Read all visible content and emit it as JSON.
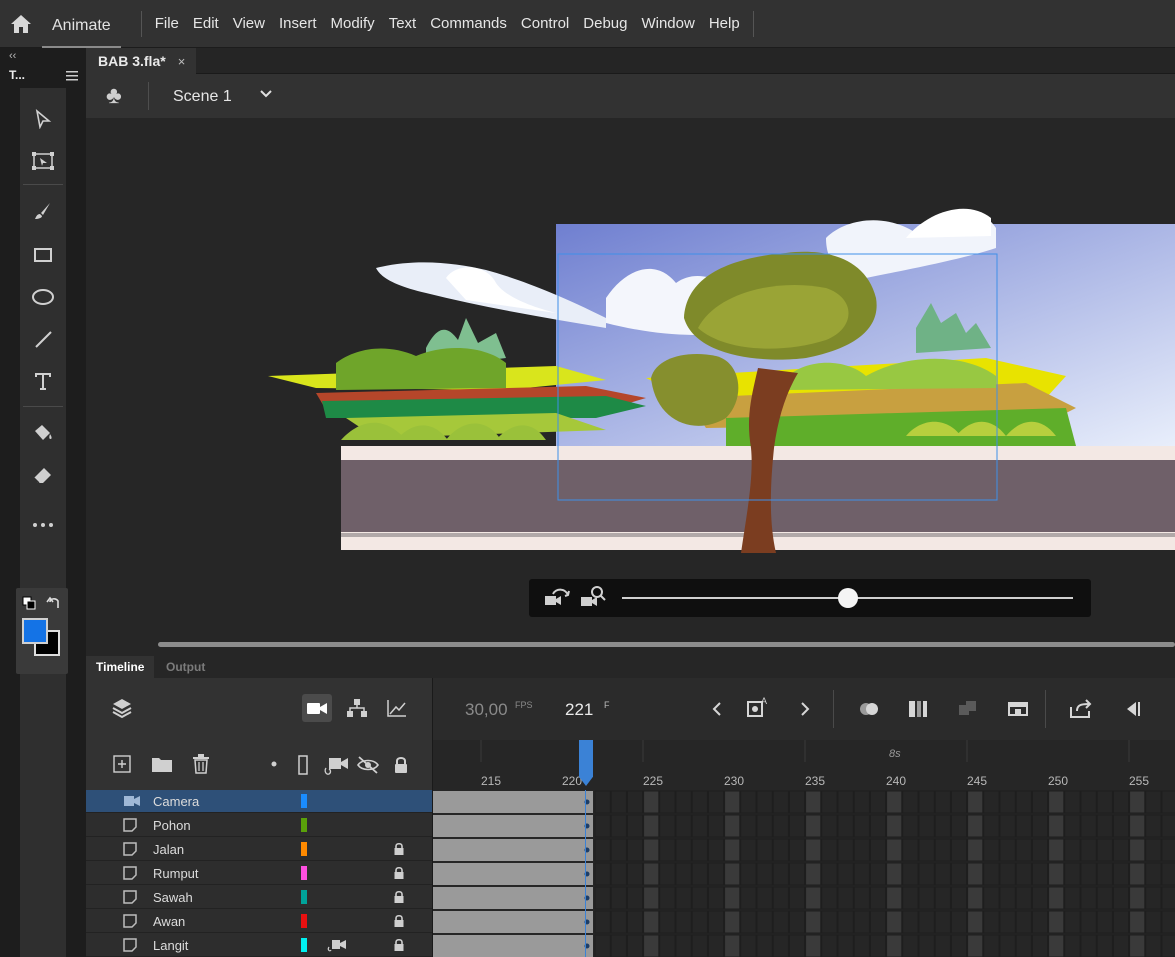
{
  "app": {
    "name": "Animate"
  },
  "menu": [
    "File",
    "Edit",
    "View",
    "Insert",
    "Modify",
    "Text",
    "Commands",
    "Control",
    "Debug",
    "Window",
    "Help"
  ],
  "tools_panel": {
    "collapse_label": "‹‹",
    "title": "T..."
  },
  "document": {
    "tab_title": "BAB 3.fla*",
    "close_glyph": "×"
  },
  "scene": {
    "name": "Scene 1"
  },
  "timeline": {
    "tabs": {
      "timeline": "Timeline",
      "output": "Output"
    },
    "fps_value": "30,00",
    "fps_unit": "FPS",
    "frame_value": "221",
    "frame_unit": "F",
    "time_marker": "8s",
    "ruler_ticks": [
      "215",
      "220",
      "225",
      "230",
      "235",
      "240",
      "245",
      "250",
      "255"
    ],
    "layers": [
      {
        "name": "Camera",
        "color": "#1a8cff",
        "selected": true,
        "locked": false
      },
      {
        "name": "Pohon",
        "color": "#5aa10a",
        "selected": false,
        "locked": false
      },
      {
        "name": "Jalan",
        "color": "#ff8a00",
        "selected": false,
        "locked": true
      },
      {
        "name": "Rumput",
        "color": "#ff4fe0",
        "selected": false,
        "locked": true
      },
      {
        "name": "Sawah",
        "color": "#00a39a",
        "selected": false,
        "locked": true
      },
      {
        "name": "Awan",
        "color": "#e81010",
        "selected": false,
        "locked": true
      },
      {
        "name": "Langit",
        "color": "#00f0f0",
        "selected": false,
        "locked": true
      }
    ]
  },
  "colors": {
    "accent": "#1473e6",
    "selection": "#2e5078",
    "playhead": "#3b82d6"
  }
}
